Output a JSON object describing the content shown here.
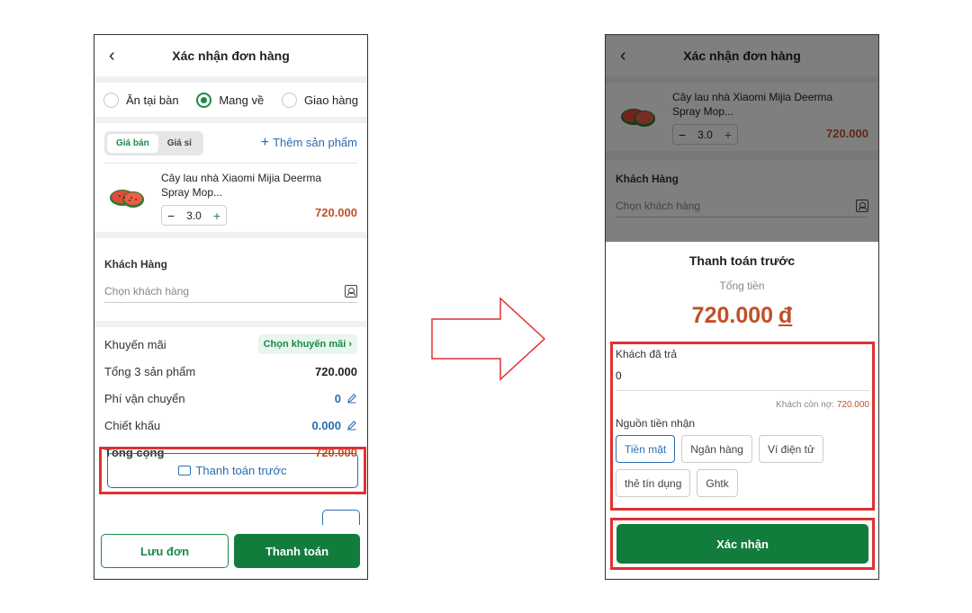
{
  "left": {
    "header": {
      "back": "‹",
      "title": "Xác nhận đơn hàng"
    },
    "order_types": [
      {
        "label": "Ăn tại bàn",
        "selected": false
      },
      {
        "label": "Mang về",
        "selected": true
      },
      {
        "label": "Giao hàng",
        "selected": false
      }
    ],
    "price_tabs": {
      "retail": "Giá bán",
      "wholesale": "Giá sỉ",
      "active": "Giá bán"
    },
    "add_product": "Thêm sản phẩm",
    "product": {
      "name_line1": "Cây lau nhà Xiaomi Mijia Deerma",
      "name_line2": "Spray Mop...",
      "qty": "3.0",
      "price": "720.000"
    },
    "customer": {
      "title": "Khách Hàng",
      "placeholder": "Chọn khách hàng"
    },
    "summary": {
      "promo_label": "Khuyến mãi",
      "promo_button": "Chọn khuyến mãi ›",
      "subtotal_label": "Tổng 3 sản phẩm",
      "subtotal_value": "720.000",
      "shipping_label": "Phí vận chuyển",
      "shipping_value": "0",
      "discount_label": "Chiết khấu",
      "discount_value": "0.000",
      "total_label": "Tổng cộng",
      "total_value": "720.000"
    },
    "prepay_button": "Thanh toán trước",
    "footer": {
      "save": "Lưu đơn",
      "pay": "Thanh toán"
    }
  },
  "right": {
    "header": {
      "back": "‹",
      "title": "Xác nhận đơn hàng"
    },
    "product": {
      "name_line1": "Cây lau nhà Xiaomi Mijia Deerma",
      "name_line2": "Spray Mop...",
      "qty": "3.0",
      "price": "720.000"
    },
    "customer": {
      "title": "Khách Hàng",
      "placeholder": "Chọn khách hàng"
    },
    "sheet": {
      "title": "Thanh toán trước",
      "subtitle": "Tổng tiền",
      "amount": "720.000",
      "currency": "đ",
      "paid_label": "Khách đã trả",
      "paid_value": "0",
      "debt_label": "Khách còn nợ:",
      "debt_value": "720.000",
      "source_label": "Nguồn tiền nhận",
      "sources": [
        "Tiền mặt",
        "Ngân hàng",
        "Ví điện tử",
        "thẻ tín dụng",
        "Ghtk"
      ],
      "active_source": "Tiền mặt",
      "confirm": "Xác nhận"
    }
  },
  "colors": {
    "green": "#127c3c",
    "red_highlight": "#e03131",
    "price": "#c0502a",
    "blue": "#2b6cb0"
  }
}
